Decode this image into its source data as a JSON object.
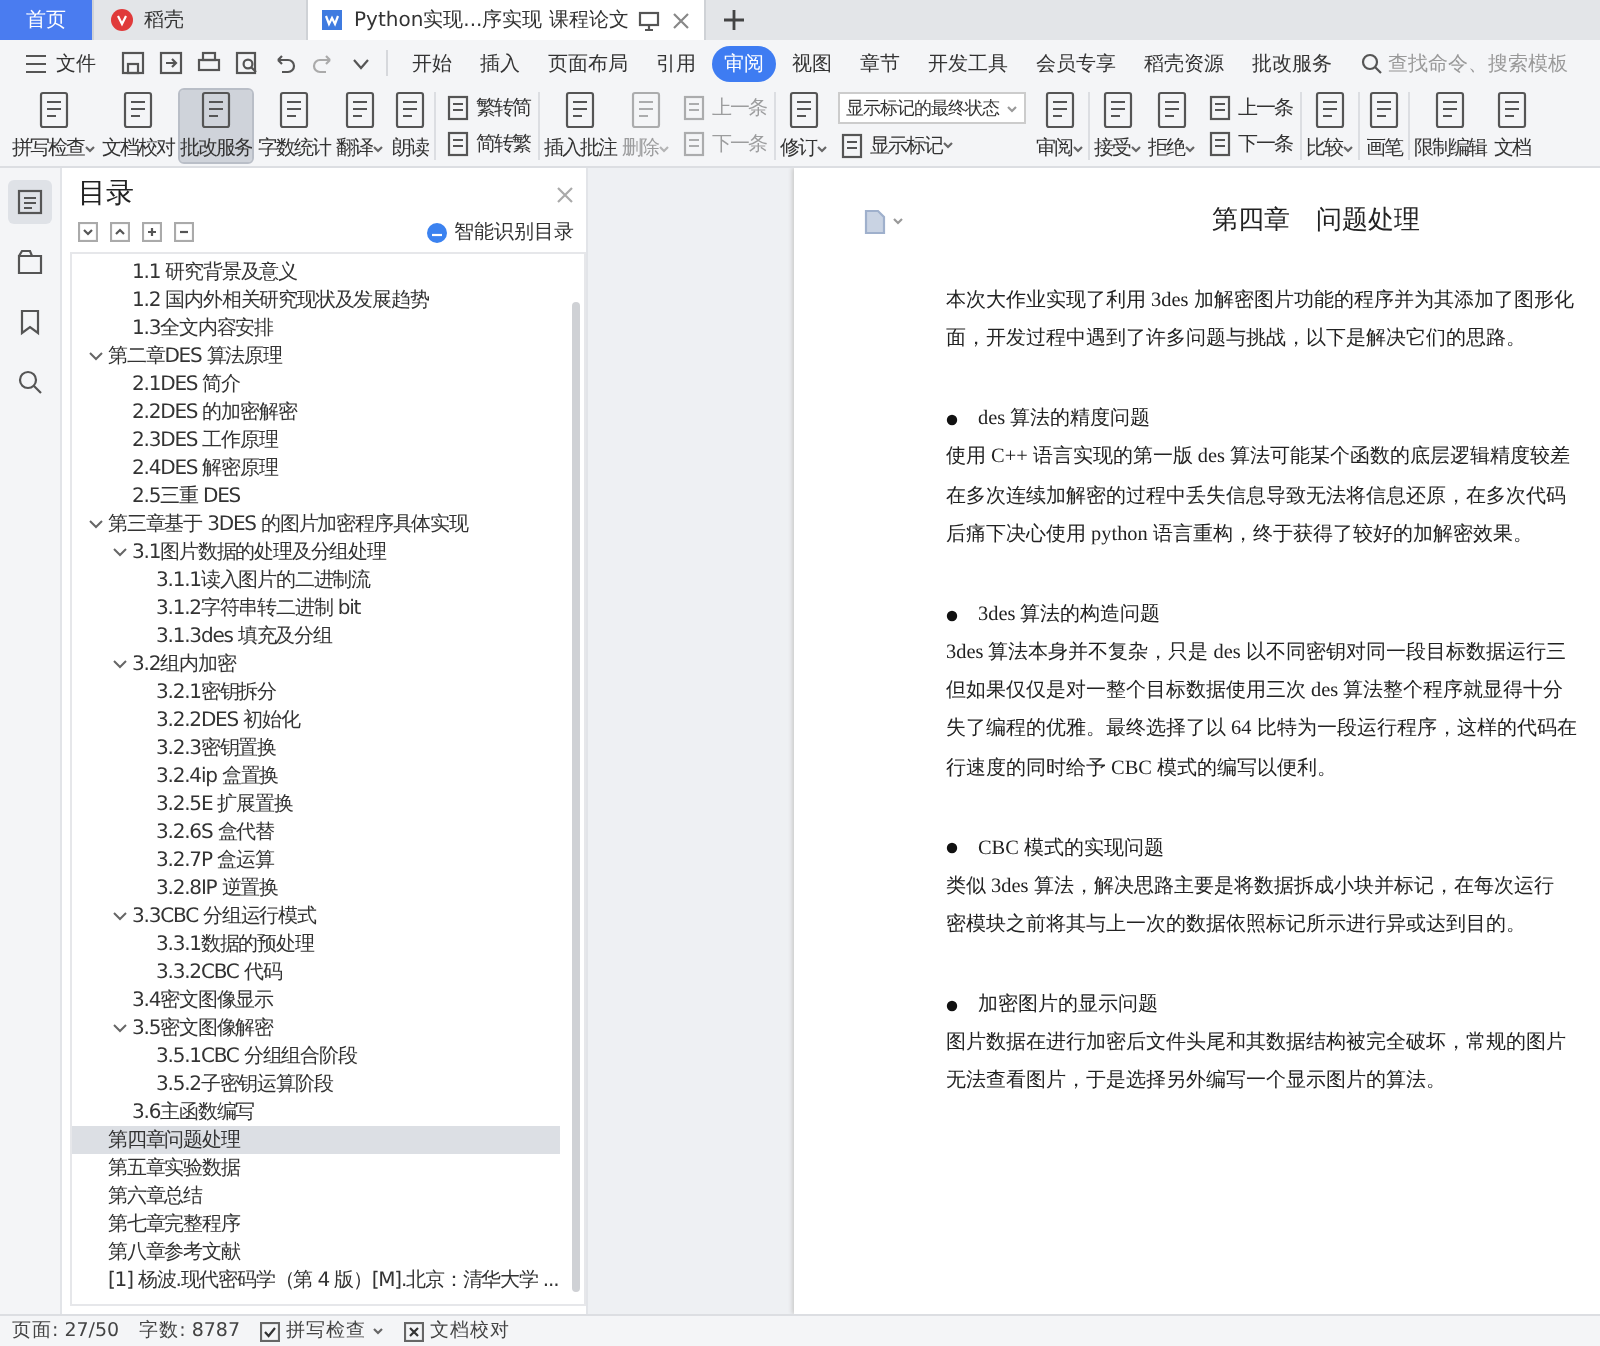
{
  "tabs": [
    {
      "label": "首页",
      "kind": "home",
      "selected": false
    },
    {
      "label": "稻壳",
      "kind": "docer",
      "selected": false
    },
    {
      "label": "Python实现...序实现 课程论文",
      "kind": "document",
      "selected": true
    }
  ],
  "menu": {
    "file": "文件",
    "search_placeholder": "查找命令、搜索模板",
    "items": [
      {
        "label": "开始",
        "selected": false
      },
      {
        "label": "插入",
        "selected": false
      },
      {
        "label": "页面布局",
        "selected": false
      },
      {
        "label": "引用",
        "selected": false
      },
      {
        "label": "审阅",
        "selected": true
      },
      {
        "label": "视图",
        "selected": false
      },
      {
        "label": "章节",
        "selected": false
      },
      {
        "label": "开发工具",
        "selected": false
      },
      {
        "label": "会员专享",
        "selected": false
      },
      {
        "label": "稻壳资源",
        "selected": false
      },
      {
        "label": "批改服务",
        "selected": false
      }
    ]
  },
  "ribbon": [
    {
      "items": [
        {
          "kind": "large",
          "label": "拼写检查",
          "caret": true,
          "pressed": false,
          "disabled": false
        },
        {
          "kind": "large",
          "label": "文档校对",
          "caret": false,
          "pressed": false,
          "disabled": false
        },
        {
          "kind": "large",
          "label": "批改服务",
          "caret": false,
          "pressed": true,
          "disabled": false
        },
        {
          "kind": "large",
          "label": "字数统计",
          "caret": false,
          "pressed": false,
          "disabled": false
        },
        {
          "kind": "large",
          "label": "翻译",
          "caret": true,
          "pressed": false,
          "disabled": false
        },
        {
          "kind": "large",
          "label": "朗读",
          "caret": false,
          "pressed": false,
          "disabled": false
        }
      ]
    },
    {
      "items": [
        {
          "kind": "stack",
          "items": [
            {
              "kind": "small",
              "label": "繁转简",
              "caret": false,
              "pressed": false,
              "disabled": false
            },
            {
              "kind": "small",
              "label": "简转繁",
              "caret": false,
              "pressed": false,
              "disabled": false
            }
          ]
        }
      ]
    },
    {
      "items": [
        {
          "kind": "large",
          "label": "插入批注",
          "caret": false,
          "pressed": false,
          "disabled": false
        },
        {
          "kind": "large",
          "label": "删除",
          "caret": true,
          "pressed": false,
          "disabled": true
        },
        {
          "kind": "stack",
          "items": [
            {
              "kind": "small",
              "label": "上一条",
              "caret": false,
              "pressed": false,
              "disabled": true
            },
            {
              "kind": "small",
              "label": "下一条",
              "caret": false,
              "pressed": false,
              "disabled": true
            }
          ]
        }
      ]
    },
    {
      "items": [
        {
          "kind": "large",
          "label": "修订",
          "caret": true,
          "pressed": false,
          "disabled": false
        },
        {
          "kind": "stack",
          "items": [
            {
              "kind": "select",
              "value": "显示标记的最终状态"
            },
            {
              "kind": "small",
              "label": "显示标记",
              "caret": true,
              "pressed": false,
              "disabled": false
            }
          ]
        },
        {
          "kind": "large",
          "label": "审阅",
          "caret": true,
          "pressed": false,
          "disabled": false
        }
      ]
    },
    {
      "items": [
        {
          "kind": "large",
          "label": "接受",
          "caret": true,
          "pressed": false,
          "disabled": false
        },
        {
          "kind": "large",
          "label": "拒绝",
          "caret": true,
          "pressed": false,
          "disabled": false
        },
        {
          "kind": "stack",
          "items": [
            {
              "kind": "small",
              "label": "上一条",
              "caret": false,
              "pressed": false,
              "disabled": false
            },
            {
              "kind": "small",
              "label": "下一条",
              "caret": false,
              "pressed": false,
              "disabled": false
            }
          ]
        }
      ]
    },
    {
      "items": [
        {
          "kind": "large",
          "label": "比较",
          "caret": true,
          "pressed": false,
          "disabled": false
        }
      ]
    },
    {
      "items": [
        {
          "kind": "large",
          "label": "画笔",
          "caret": false,
          "pressed": false,
          "disabled": false
        }
      ]
    },
    {
      "items": [
        {
          "kind": "large",
          "label": "限制编辑",
          "caret": false,
          "pressed": false,
          "disabled": false
        },
        {
          "kind": "large",
          "label": "文档",
          "caret": false,
          "pressed": false,
          "disabled": false
        }
      ]
    }
  ],
  "side_tools": [
    {
      "selected": true
    },
    {
      "selected": false
    },
    {
      "selected": false
    },
    {
      "selected": false
    }
  ],
  "toc": {
    "title": "目录",
    "smart_button": "智能识别目录",
    "continued": [
      {
        "label": "1.1  研究背景及意义",
        "selected": false
      },
      {
        "label": "1.2  国内外相关研究现状及发展趋势",
        "selected": false
      },
      {
        "label": "1.3全文内容安排",
        "selected": false
      }
    ],
    "items": [
      {
        "label": "第二章DES 算法原理",
        "selected": false,
        "expanded": true,
        "children": [
          {
            "label": "2.1DES 简介",
            "selected": false
          },
          {
            "label": "2.2DES 的加密解密",
            "selected": false
          },
          {
            "label": "2.3DES 工作原理",
            "selected": false
          },
          {
            "label": "2.4DES 解密原理",
            "selected": false
          },
          {
            "label": "2.5三重 DES",
            "selected": false
          }
        ]
      },
      {
        "label": "第三章基于 3DES 的图片加密程序具体实现",
        "selected": false,
        "expanded": true,
        "children": [
          {
            "label": "3.1图片数据的处理及分组处理",
            "selected": false,
            "expanded": true,
            "children": [
              {
                "label": "3.1.1读入图片的二进制流",
                "selected": false
              },
              {
                "label": "3.1.2字符串转二进制 bit",
                "selected": false
              },
              {
                "label": "3.1.3des 填充及分组",
                "selected": false
              }
            ]
          },
          {
            "label": "3.2组内加密",
            "selected": false,
            "expanded": true,
            "children": [
              {
                "label": "3.2.1密钥拆分",
                "selected": false
              },
              {
                "label": "3.2.2DES 初始化",
                "selected": false
              },
              {
                "label": "3.2.3密钥置换",
                "selected": false
              },
              {
                "label": "3.2.4ip 盒置换",
                "selected": false
              },
              {
                "label": "3.2.5E 扩展置换",
                "selected": false
              },
              {
                "label": "3.2.6S 盒代替",
                "selected": false
              },
              {
                "label": "3.2.7P 盒运算",
                "selected": false
              },
              {
                "label": "3.2.8IP 逆置换",
                "selected": false
              }
            ]
          },
          {
            "label": "3.3CBC 分组运行模式",
            "selected": false,
            "expanded": true,
            "children": [
              {
                "label": "3.3.1数据的预处理",
                "selected": false
              },
              {
                "label": "3.3.2CBC 代码",
                "selected": false
              }
            ]
          },
          {
            "label": "3.4密文图像显示",
            "selected": false
          },
          {
            "label": "3.5密文图像解密",
            "selected": false,
            "expanded": true,
            "children": [
              {
                "label": "3.5.1CBC 分组组合阶段",
                "selected": false
              },
              {
                "label": "3.5.2子密钥运算阶段",
                "selected": false
              }
            ]
          },
          {
            "label": "3.6主函数编写",
            "selected": false
          }
        ]
      },
      {
        "label": "第四章问题处理",
        "selected": true
      },
      {
        "label": "第五章实验数据",
        "selected": false
      },
      {
        "label": "第六章总结",
        "selected": false
      },
      {
        "label": "第七章完整程序",
        "selected": false
      },
      {
        "label": "第八章参考文献",
        "selected": false
      },
      {
        "label": "[1] 杨波.现代密码学（第 4 版）[M].北京：清华大学 ...",
        "selected": false
      }
    ]
  },
  "document": {
    "heading": "第四章　问题处理",
    "blocks": [
      {
        "kind": "paragraph",
        "lines": [
          "本次大作业实现了利用 3des 加解密图片功能的程序并为其添加了图形化",
          "面，开发过程中遇到了许多问题与挑战，以下是解决它们的思路。"
        ]
      },
      {
        "kind": "bullet",
        "text": "des 算法的精度问题"
      },
      {
        "kind": "paragraph",
        "lines": [
          "使用 C++ 语言实现的第一版 des 算法可能某个函数的底层逻辑精度较差",
          "在多次连续加解密的过程中丢失信息导致无法将信息还原，在多次代码",
          "后痛下决心使用 python 语言重构，终于获得了较好的加解密效果。"
        ]
      },
      {
        "kind": "bullet",
        "text": "3des 算法的构造问题"
      },
      {
        "kind": "paragraph",
        "lines": [
          "3des 算法本身并不复杂，只是 des 以不同密钥对同一段目标数据运行三",
          "但如果仅仅是对一整个目标数据使用三次 des 算法整个程序就显得十分",
          "失了编程的优雅。最终选择了以 64 比特为一段运行程序，这样的代码在",
          "行速度的同时给予 CBC 模式的编写以便利。"
        ]
      },
      {
        "kind": "bullet",
        "text": "CBC 模式的实现问题"
      },
      {
        "kind": "paragraph",
        "lines": [
          "类似 3des 算法，解决思路主要是将数据拆成小块并标记，在每次运行",
          "密模块之前将其与上一次的数据依照标记所示进行异或达到目的。"
        ]
      },
      {
        "kind": "bullet",
        "text": "加密图片的显示问题"
      },
      {
        "kind": "paragraph",
        "lines": [
          "图片数据在进行加密后文件头尾和其数据结构被完全破坏，常规的图片",
          "无法查看图片，于是选择另外编写一个显示图片的算法。"
        ]
      }
    ]
  },
  "status_bar": {
    "page": "页面: 27/50",
    "words": "字数: 8787",
    "spell": "拼写检查",
    "proof": "文档校对"
  }
}
